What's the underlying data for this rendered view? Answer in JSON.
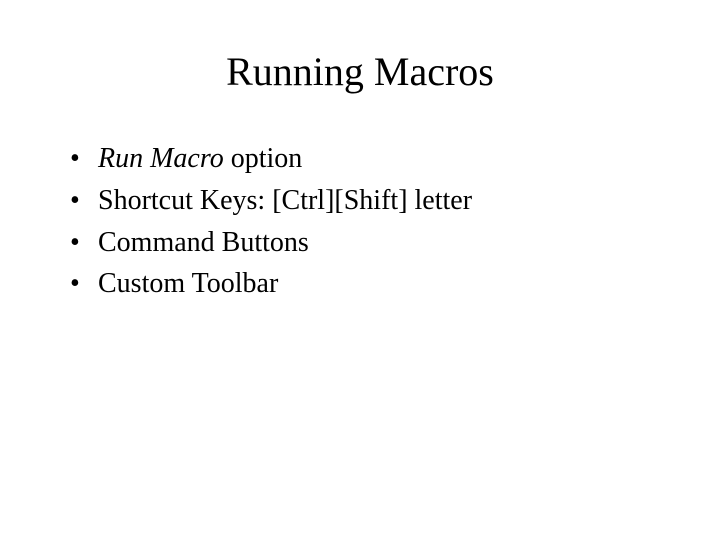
{
  "title": "Running Macros",
  "bullets": {
    "b1_italic": "Run Macro",
    "b1_rest": " option",
    "b2": "Shortcut Keys: [Ctrl][Shift] letter",
    "b3": "Command Buttons",
    "b4": "Custom Toolbar"
  },
  "bullet_marker": "•"
}
